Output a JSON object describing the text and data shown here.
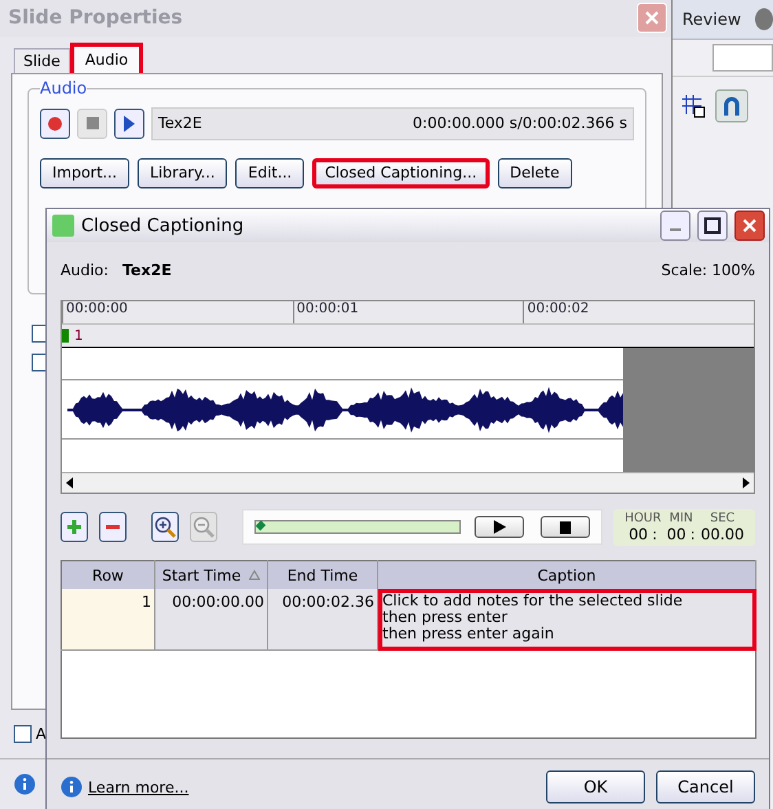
{
  "app": {
    "ribbon_tab": "Review"
  },
  "slide_properties": {
    "title": "Slide Properties",
    "tabs": [
      {
        "label": "Slide",
        "selected": false,
        "highlighted": false
      },
      {
        "label": "Audio",
        "selected": true,
        "highlighted": true
      }
    ],
    "audio_group": {
      "label": "Audio",
      "clip_name": "Tex2E",
      "time": "0:00:00.000 s/0:00:02.366 s",
      "buttons": [
        {
          "label": "Import...",
          "highlighted": false
        },
        {
          "label": "Library...",
          "highlighted": false
        },
        {
          "label": "Edit...",
          "highlighted": false
        },
        {
          "label": "Closed Captioning...",
          "highlighted": true
        },
        {
          "label": "Delete",
          "highlighted": false
        }
      ]
    },
    "checkboxes": [
      {
        "checked": false
      },
      {
        "checked": false
      }
    ],
    "bottom_checkbox": {
      "label": "A",
      "checked": false
    }
  },
  "captioning": {
    "title": "Closed Captioning",
    "audio_label": "Audio:",
    "audio_name": "Tex2E",
    "scale": "Scale: 100%",
    "ruler": [
      "00:00:00",
      "00:00:01",
      "00:00:02"
    ],
    "marker": "1",
    "tools": [
      {
        "kind": "add",
        "disabled": false
      },
      {
        "kind": "remove",
        "disabled": false
      },
      {
        "kind": "zoom-in",
        "disabled": false
      },
      {
        "kind": "zoom-out",
        "disabled": true
      }
    ],
    "playback": {
      "level": 0.02
    },
    "clock": [
      {
        "label": "HOUR",
        "value": "00",
        "separator": ":"
      },
      {
        "label": "MIN",
        "value": "00",
        "separator": ":"
      },
      {
        "label": "SEC",
        "value": "00.00"
      }
    ],
    "table": {
      "columns": [
        {
          "label": "Row",
          "sorted": false
        },
        {
          "label": "Start Time",
          "sorted": true
        },
        {
          "label": "End Time",
          "sorted": false
        },
        {
          "label": "Caption",
          "sorted": false
        }
      ],
      "rows": [
        {
          "row": "1",
          "start": "00:00:00.00",
          "end": "00:00:02.36",
          "caption": [
            "Click to add notes for the selected slide",
            "then press enter",
            "then press enter again"
          ],
          "highlighted": true
        }
      ]
    },
    "learn_more": "Learn more...",
    "buttons": [
      "OK",
      "Cancel"
    ]
  }
}
